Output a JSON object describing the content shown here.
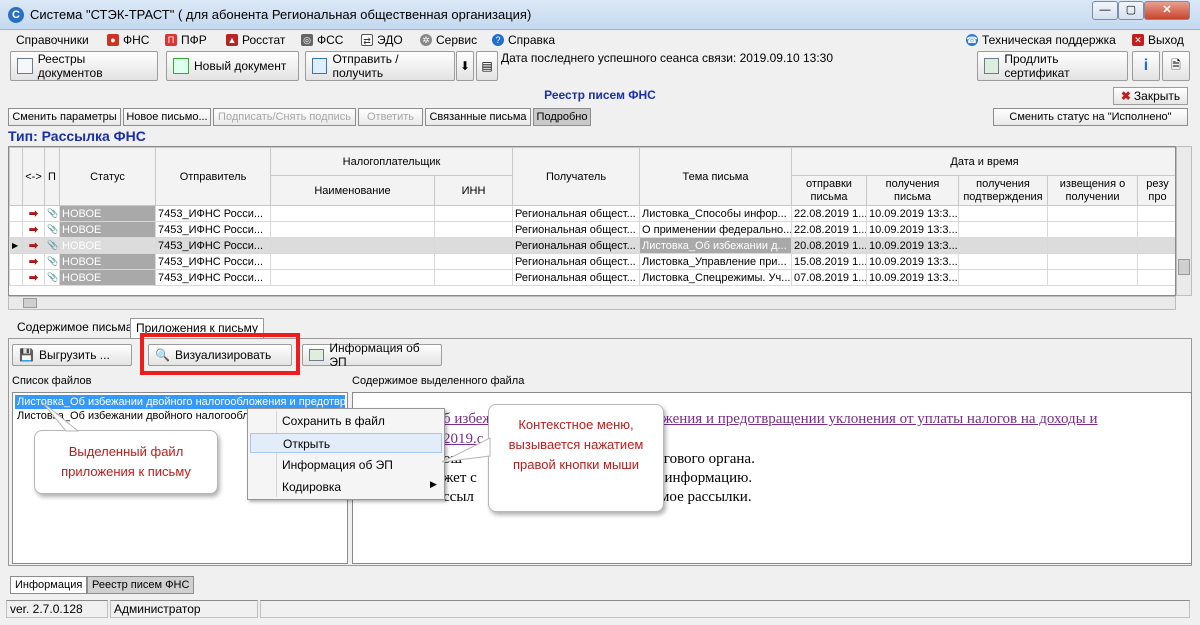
{
  "window": {
    "title": "Система \"СТЭК-ТРАСТ\" ( для абонента Региональная общественная организация)",
    "app_icon": "C",
    "controls": {
      "minimize": "—",
      "maximize": "▢",
      "close": "✕"
    }
  },
  "menu": {
    "items": [
      "Справочники",
      "ФНС",
      "ПФР",
      "Росстат",
      "ФСС",
      "ЭДО",
      "Сервис",
      "Справка"
    ],
    "support": "Техническая поддержка",
    "exit": "Выход"
  },
  "toolbar": {
    "registry": "Реестры документов",
    "new_doc": "Новый документ",
    "send": "Отправить / получить",
    "last_session": "Дата последнего успешного сеанса связи: 2019.09.10 13:30",
    "extend_cert": "Продлить сертификат"
  },
  "panel": {
    "title": "Реестр писем ФНС",
    "close": "Закрыть",
    "actions": {
      "change_params": "Сменить параметры",
      "new_letter": "Новое письмо...",
      "sign": "Подписать/Снять подпись",
      "reply": "Ответить",
      "linked": "Связанные письма",
      "details": "Подробно",
      "set_done": "Сменить статус на \"Исполнено\""
    },
    "type_label": "Тип: Рассылка ФНС"
  },
  "grid": {
    "headers": {
      "dir": "<->",
      "p": "П",
      "status": "Статус",
      "sender": "Отправитель",
      "taxpayer": "Налогоплательщик",
      "name": "Наименование",
      "inn": "ИНН",
      "recipient": "Получатель",
      "subject": "Тема письма",
      "datetime": "Дата и время",
      "sent": "отправки письма",
      "received": "получения письма",
      "confirm": "получения подтверждения",
      "notice": "извещения о получении",
      "result": "резу про"
    },
    "rows": [
      {
        "status": "НОВОЕ",
        "sender": "7453_ИФНС Росси...",
        "recipient": "Региональная общест...",
        "subject": "Листовка_Способы инфор...",
        "sent": "22.08.2019 1...",
        "received": "10.09.2019 13:3..."
      },
      {
        "status": "НОВОЕ",
        "sender": "7453_ИФНС Росси...",
        "recipient": "Региональная общест...",
        "subject": "О применении федерально...",
        "sent": "22.08.2019 1...",
        "received": "10.09.2019 13:3..."
      },
      {
        "status": "НОВОЕ",
        "sender": "7453_ИФНС Росси...",
        "recipient": "Региональная общест...",
        "subject": "Листовка_Об избежании д...",
        "sent": "20.08.2019 1...",
        "received": "10.09.2019 13:3..."
      },
      {
        "status": "НОВОЕ",
        "sender": "7453_ИФНС Росси...",
        "recipient": "Региональная общест...",
        "subject": "Листовка_Управление при...",
        "sent": "15.08.2019 1...",
        "received": "10.09.2019 13:3..."
      },
      {
        "status": "НОВОЕ",
        "sender": "7453_ИФНС Росси...",
        "recipient": "Региональная общест...",
        "subject": "Листовка_Спецрежимы. Уч...",
        "sent": "07.08.2019 1...",
        "received": "10.09.2019 13:3..."
      }
    ]
  },
  "tabs": {
    "content": "Содержимое письма",
    "attachments": "Приложения к письму"
  },
  "attach_toolbar": {
    "export": "Выгрузить ...",
    "visualize": "Визуализировать",
    "signature_info": "Информация об ЭП"
  },
  "files": {
    "label": "Список файлов",
    "items": [
      "Листовка_Об избежании двойного налогообложения и предотвращении",
      "Листовка_Об избежании двойного налогообложения и предотвращении"
    ]
  },
  "content": {
    "label": "Содержимое выделенного файла",
    "line1": "б избежании двойного налогообложения и предотвращении уклонения от уплаты налогов на доходы и",
    "line1b": "2019.с",
    "line2": "налогового органа.",
    "line3": "ную информацию.",
    "line4": "ржимое рассылки.",
    "frag2": "ош",
    "frag3": "жет с",
    "frag4": "ссыл"
  },
  "context_menu": {
    "items": [
      "Сохранить в файл",
      "Открыть",
      "Информация об ЭП",
      "Кодировка"
    ]
  },
  "callouts": {
    "selected_file": "Выделенный файл приложения к письму",
    "context_menu": "Контекстное меню, вызывается нажатием правой кнопки мыши"
  },
  "bottom_tabs": {
    "info": "Информация",
    "registry": "Реестр писем ФНС"
  },
  "statusbar": {
    "version": "ver. 2.7.0.128",
    "user": "Администратор"
  }
}
